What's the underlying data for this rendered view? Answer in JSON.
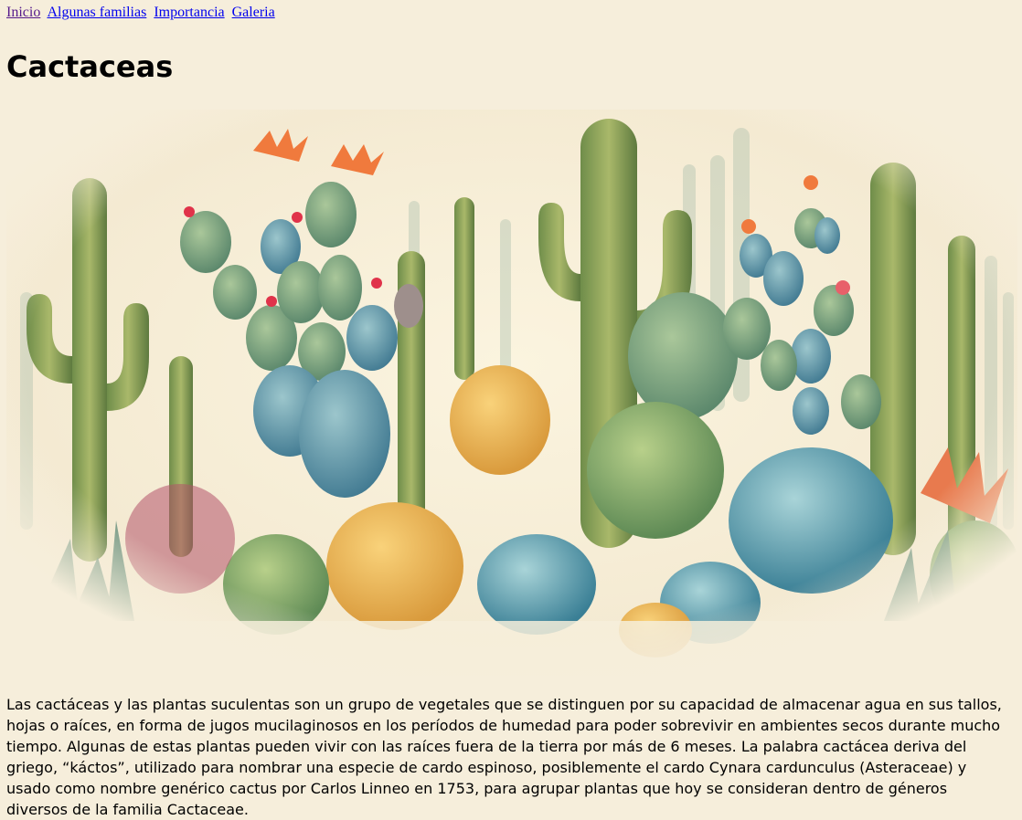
{
  "nav": {
    "items": [
      {
        "label": "Inicio"
      },
      {
        "label": "Algunas familias"
      },
      {
        "label": "Importancia"
      },
      {
        "label": "Galeria"
      }
    ]
  },
  "page": {
    "title": "Cactaceas",
    "intro": "Las cactáceas y las plantas suculentas son un grupo de vegetales que se distinguen por su capacidad de almacenar agua en sus tallos, hojas o raíces, en forma de jugos mucilaginosos en los períodos de humedad para poder sobrevivir en ambientes secos durante mucho tiempo. Algunas de estas plantas pueden vivir con las raíces fuera de la tierra por más de 6 meses. La palabra cactácea deriva del griego, “káctos”, utilizado para nombrar una especie de cardo espinoso, posiblemente el cardo Cynara cardunculus (Asteraceae) y usado como nombre genérico cactus por Carlos Linneo en 1753, para agrupar plantas que hoy se consideran dentro de géneros diversos de la familia Cactaceae."
  },
  "colors": {
    "background": "#f6eedb",
    "link": "#0000ee",
    "visited_link": "#551a8b"
  }
}
